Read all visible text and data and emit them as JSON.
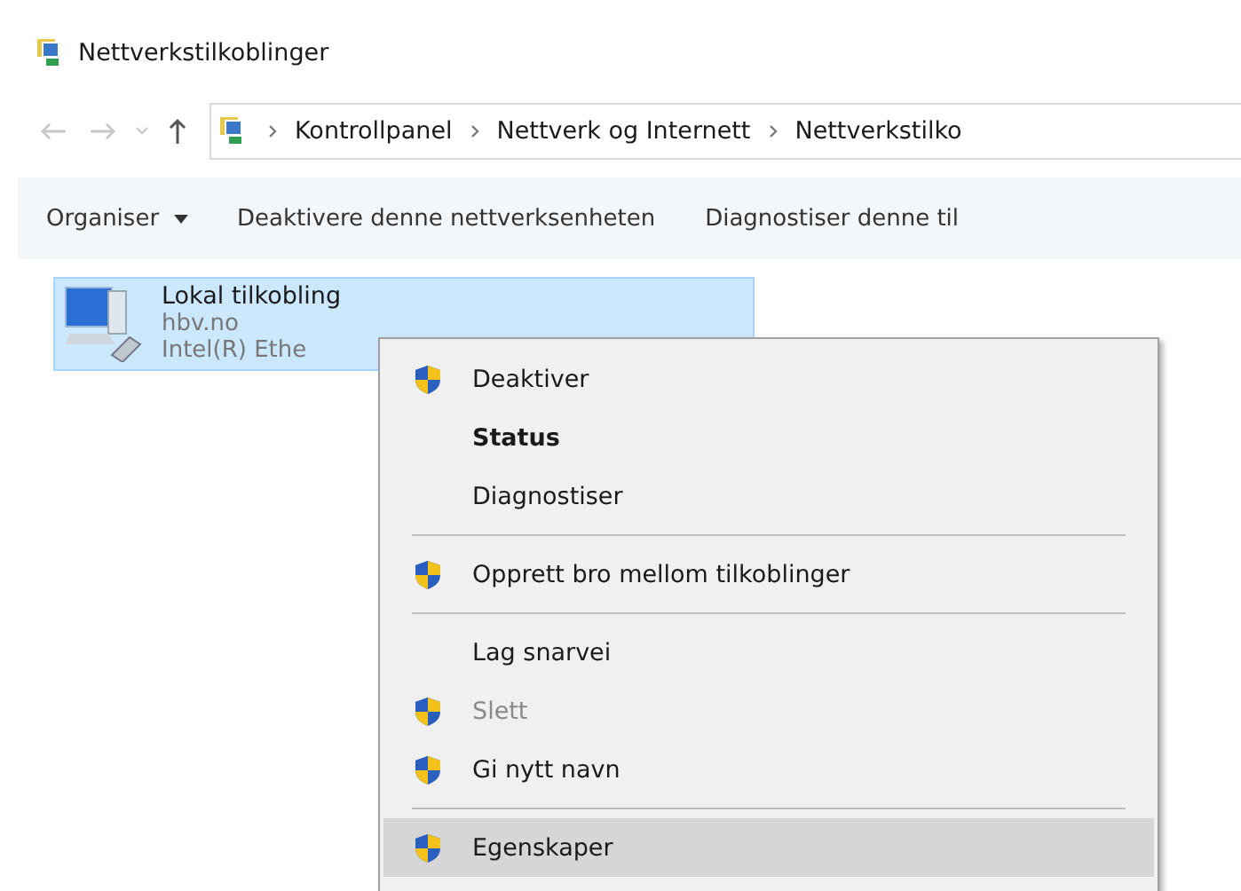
{
  "window": {
    "title": "Nettverkstilkoblinger"
  },
  "address_bar": {
    "crumbs": [
      "Kontrollpanel",
      "Nettverk og Internett",
      "Nettverkstilko"
    ]
  },
  "toolbar": {
    "items": [
      {
        "label": "Organiser",
        "dropdown": true
      },
      {
        "label": "Deaktivere denne nettverksenheten",
        "dropdown": false
      },
      {
        "label": "Diagnostiser denne til",
        "dropdown": false
      }
    ]
  },
  "connections": [
    {
      "name": "Lokal tilkobling",
      "domain": "hbv.no",
      "adapter": "Intel(R) Ethe",
      "selected": true
    }
  ],
  "context_menu": {
    "items": [
      {
        "kind": "item",
        "label": "Deaktiver",
        "shield": true,
        "bold": false,
        "disabled": false,
        "selected": false
      },
      {
        "kind": "item",
        "label": "Status",
        "shield": false,
        "bold": true,
        "disabled": false,
        "selected": false
      },
      {
        "kind": "item",
        "label": "Diagnostiser",
        "shield": false,
        "bold": false,
        "disabled": false,
        "selected": false
      },
      {
        "kind": "separator"
      },
      {
        "kind": "item",
        "label": "Opprett bro mellom tilkoblinger",
        "shield": true,
        "bold": false,
        "disabled": false,
        "selected": false
      },
      {
        "kind": "separator"
      },
      {
        "kind": "item",
        "label": "Lag snarvei",
        "shield": false,
        "bold": false,
        "disabled": false,
        "selected": false
      },
      {
        "kind": "item",
        "label": "Slett",
        "shield": true,
        "bold": false,
        "disabled": true,
        "selected": false
      },
      {
        "kind": "item",
        "label": "Gi nytt navn",
        "shield": true,
        "bold": false,
        "disabled": false,
        "selected": false
      },
      {
        "kind": "separator"
      },
      {
        "kind": "item",
        "label": "Egenskaper",
        "shield": true,
        "bold": false,
        "disabled": false,
        "selected": true
      }
    ]
  }
}
